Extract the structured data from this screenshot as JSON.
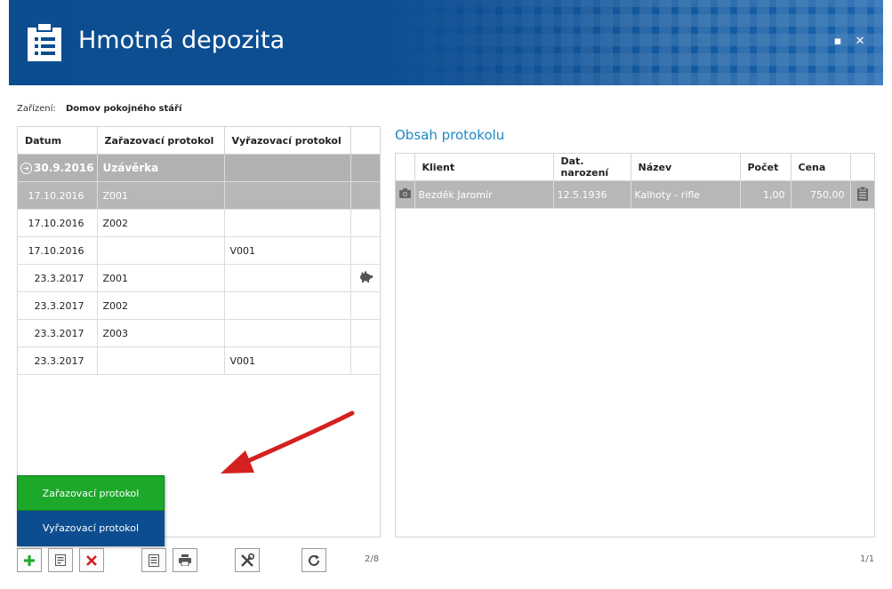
{
  "header": {
    "title": "Hmotná depozita",
    "maximize_label": "▪",
    "close_label": "✕",
    "app_icon": "clipboard-icon"
  },
  "facility": {
    "label": "Zařízení:",
    "value": "Domov pokojného stáří"
  },
  "left_table": {
    "columns": [
      "Datum",
      "Zařazovací protokol",
      "Vyřazovací protokol",
      ""
    ],
    "group_row": {
      "date": "30.9.2016",
      "label": "Uzávěrka"
    },
    "rows": [
      {
        "date": "17.10.2016",
        "in": "Z001",
        "out": "",
        "icon": "",
        "selected": true
      },
      {
        "date": "17.10.2016",
        "in": "Z002",
        "out": "",
        "icon": ""
      },
      {
        "date": "17.10.2016",
        "in": "",
        "out": "V001",
        "icon": ""
      },
      {
        "date": "23.3.2017",
        "in": "Z001",
        "out": "",
        "icon": "piggy-bank-icon"
      },
      {
        "date": "23.3.2017",
        "in": "Z002",
        "out": "",
        "icon": ""
      },
      {
        "date": "23.3.2017",
        "in": "Z003",
        "out": "",
        "icon": ""
      },
      {
        "date": "23.3.2017",
        "in": "",
        "out": "V001",
        "icon": ""
      }
    ]
  },
  "right": {
    "title": "Obsah protokolu",
    "columns": [
      "",
      "Klient",
      "Dat. narození",
      "Název",
      "Počet",
      "Cena",
      ""
    ],
    "rows": [
      {
        "client": "Bezděk Jaromír",
        "birth": "12.5.1936",
        "name": "Kalhoty - rifle",
        "count": "1,00",
        "price": "750,00"
      }
    ]
  },
  "popup": {
    "items": [
      "Zařazovací protokol",
      "Vyřazovací protokol"
    ]
  },
  "toolbar": {
    "icons": [
      "add-icon",
      "edit-icon",
      "delete-icon",
      "document-icon",
      "print-icon",
      "tools-icon",
      "refresh-icon"
    ]
  },
  "pager": {
    "left": "2/8",
    "right": "1/1"
  },
  "colors": {
    "header_blue": "#0c4d8f",
    "accent_green": "#1ca92a",
    "title_blue": "#1f88c8",
    "selection_gray": "#b7b7b7",
    "arrow_red": "#d42020"
  }
}
